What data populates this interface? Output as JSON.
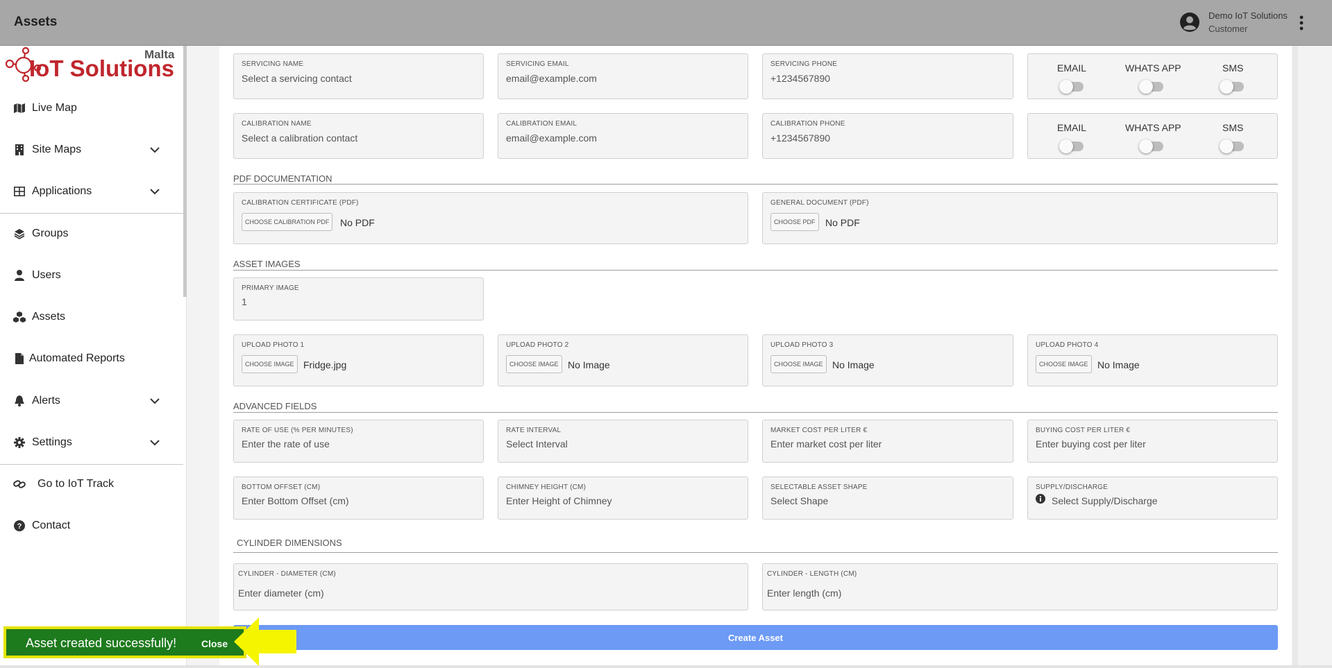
{
  "header": {
    "title": "Assets",
    "user_name": "Demo IoT Solutions",
    "user_role": "Customer"
  },
  "logo": {
    "main": "IoT Solutions",
    "region": "Malta"
  },
  "sidebar": {
    "items": [
      {
        "label": "Live Map",
        "icon": "map-icon"
      },
      {
        "label": "Site Maps",
        "icon": "building-icon",
        "expandable": true
      },
      {
        "label": "Applications",
        "icon": "grid-icon",
        "expandable": true
      },
      {
        "label": "Groups",
        "icon": "layers-icon"
      },
      {
        "label": "Users",
        "icon": "user-icon"
      },
      {
        "label": "Assets",
        "icon": "cubes-icon"
      },
      {
        "label": "Automated Reports",
        "icon": "document-icon"
      },
      {
        "label": "Alerts",
        "icon": "bell-icon",
        "expandable": true
      },
      {
        "label": "Settings",
        "icon": "gear-icon",
        "expandable": true
      },
      {
        "label": "Go to IoT Track",
        "icon": "link-icon"
      },
      {
        "label": "Contact",
        "icon": "help-icon"
      }
    ]
  },
  "contacts": {
    "servicing_name": {
      "label": "SERVICING NAME",
      "placeholder": "Select a servicing contact"
    },
    "servicing_email": {
      "label": "SERVICING EMAIL",
      "placeholder": "email@example.com"
    },
    "servicing_phone": {
      "label": "SERVICING PHONE",
      "placeholder": "+1234567890"
    },
    "calibration_name": {
      "label": "CALIBRATION NAME",
      "placeholder": "Select a calibration contact"
    },
    "calibration_email": {
      "label": "CALIBRATION EMAIL",
      "placeholder": "email@example.com"
    },
    "calibration_phone": {
      "label": "CALIBRATION PHONE",
      "placeholder": "+1234567890"
    },
    "toggles": {
      "email": "EMAIL",
      "whatsapp": "WHATS APP",
      "sms": "SMS"
    }
  },
  "pdf": {
    "section": "PDF DOCUMENTATION",
    "calibration": {
      "label": "CALIBRATION CERTIFICATE (PDF)",
      "button": "CHOOSE CALIBRATION PDF",
      "value": "No PDF"
    },
    "general": {
      "label": "GENERAL DOCUMENT (PDF)",
      "button": "CHOOSE PDF",
      "value": "No PDF"
    }
  },
  "images": {
    "section": "ASSET IMAGES",
    "primary": {
      "label": "PRIMARY IMAGE",
      "value": "1"
    },
    "photos": [
      {
        "label": "UPLOAD PHOTO 1",
        "button": "CHOOSE IMAGE",
        "value": "Fridge.jpg"
      },
      {
        "label": "UPLOAD PHOTO 2",
        "button": "CHOOSE IMAGE",
        "value": "No Image"
      },
      {
        "label": "UPLOAD PHOTO 3",
        "button": "CHOOSE IMAGE",
        "value": "No Image"
      },
      {
        "label": "UPLOAD PHOTO 4",
        "button": "CHOOSE IMAGE",
        "value": "No Image"
      }
    ]
  },
  "advanced": {
    "section": "ADVANCED FIELDS",
    "rate_of_use": {
      "label": "RATE OF USE (% PER MINUTES)",
      "placeholder": "Enter the rate of use"
    },
    "rate_interval": {
      "label": "RATE INTERVAL",
      "placeholder": "Select Interval"
    },
    "market_cost": {
      "label": "MARKET COST PER LITER €",
      "placeholder": "Enter market cost per liter"
    },
    "buying_cost": {
      "label": "BUYING COST PER LITER €",
      "placeholder": "Enter buying cost per liter"
    },
    "bottom_offset": {
      "label": "BOTTOM OFFSET (CM)",
      "placeholder": "Enter Bottom Offset (cm)"
    },
    "chimney_height": {
      "label": "CHIMNEY HEIGHT (CM)",
      "placeholder": "Enter Height of Chimney"
    },
    "asset_shape": {
      "label": "SELECTABLE ASSET SHAPE",
      "placeholder": "Select Shape"
    },
    "supply_discharge": {
      "label": "SUPPLY/DISCHARGE",
      "placeholder": "Select Supply/Discharge"
    }
  },
  "cylinder": {
    "section": "CYLINDER DIMENSIONS",
    "diameter": {
      "label": "CYLINDER - DIAMETER (CM)",
      "placeholder": "Enter diameter (cm)"
    },
    "length": {
      "label": "CYLINDER - LENGTH (CM)",
      "placeholder": "Enter length (cm)"
    }
  },
  "actions": {
    "create": "Create Asset"
  },
  "toast": {
    "message": "Asset created successfully!",
    "close": "Close"
  },
  "colors": {
    "topbar": "#a7a7a7",
    "primary_button": "#6c9af5",
    "toast_bg": "#1d7a1d",
    "highlight": "#e4e400",
    "logo_red": "#c0262d"
  }
}
